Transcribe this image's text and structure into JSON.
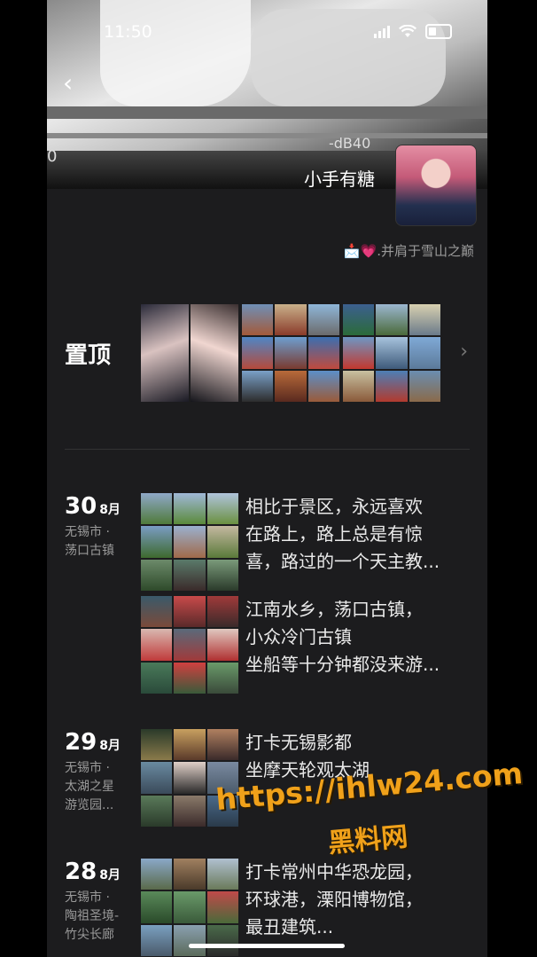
{
  "status_bar": {
    "time": "11:50"
  },
  "cover": {
    "db_text": "-dB40",
    "zero_text": "0"
  },
  "profile": {
    "nickname": "小手有糖",
    "signature_prefix": "📩",
    "signature_heart": "💗",
    "signature_text": ".并肩于雪山之巅"
  },
  "pinned": {
    "label": "置顶"
  },
  "posts": [
    {
      "day": "30",
      "month": "8月",
      "location": [
        "无锡市 ·",
        "荡口古镇"
      ],
      "entries": [
        {
          "lines": [
            "相比于景区，永远喜欢",
            "在路上，路上总是有惊",
            "喜，路过的一个天主教..."
          ]
        },
        {
          "lines": [
            "江南水乡，荡口古镇，",
            "小众冷门古镇",
            "坐船等十分钟都没来游..."
          ]
        }
      ]
    },
    {
      "day": "29",
      "month": "8月",
      "location": [
        "无锡市 ·",
        "太湖之星",
        "游览园..."
      ],
      "entries": [
        {
          "lines": [
            "打卡无锡影都",
            "坐摩天轮观太湖"
          ]
        }
      ]
    },
    {
      "day": "28",
      "month": "8月",
      "location": [
        "无锡市 ·",
        "陶祖圣境-",
        "竹尖长廊"
      ],
      "entries": [
        {
          "lines": [
            "打卡常州中华恐龙园，",
            "环球港，溧阳博物馆，",
            "最丑建筑..."
          ]
        }
      ]
    }
  ],
  "watermark": {
    "url": "https://ihlw24.com",
    "name": "黑料网"
  }
}
